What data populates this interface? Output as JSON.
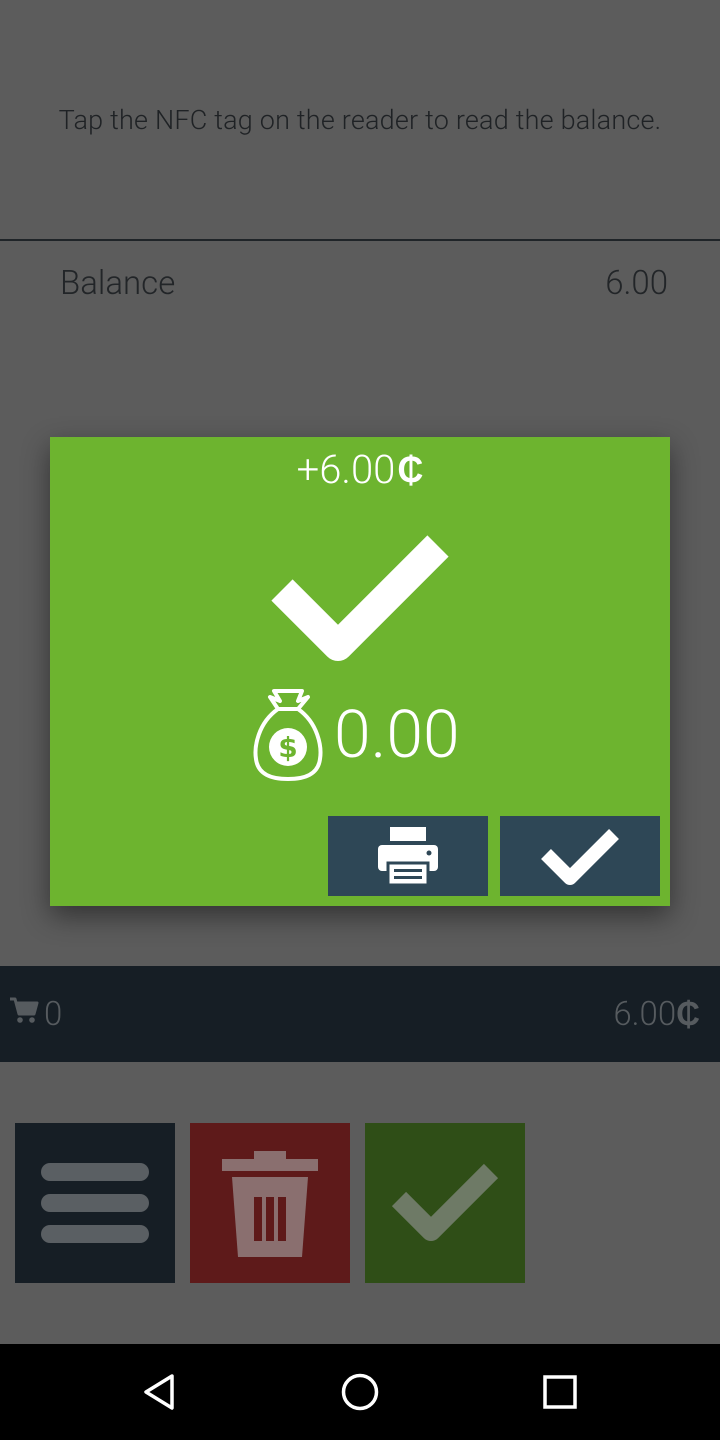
{
  "instruction": "Tap the NFC tag on the reader to read the balance.",
  "balance": {
    "label": "Balance",
    "value": "6.00"
  },
  "cart": {
    "count": "0",
    "total": "6.00",
    "currency_symbol": "₵"
  },
  "actions": {
    "menu_icon": "hamburger-menu-icon",
    "trash_icon": "trash-icon",
    "confirm_icon": "checkmark-icon"
  },
  "dialog": {
    "amount": "+6.00",
    "currency_symbol": "₵",
    "new_balance": "0.00",
    "success_icon": "checkmark-icon",
    "money_icon": "money-bag-icon",
    "print_icon": "printer-icon",
    "ok_icon": "checkmark-icon"
  },
  "colors": {
    "background": "#5c5c5c",
    "dialog_green": "#6db42f",
    "dialog_button": "#2e4756",
    "bar_dark": "#161e25",
    "trash_red": "#5e1a1a",
    "confirm_green": "#2f4e17"
  },
  "navbar": {
    "back_icon": "back-triangle-icon",
    "home_icon": "home-circle-icon",
    "recent_icon": "recent-square-icon"
  }
}
